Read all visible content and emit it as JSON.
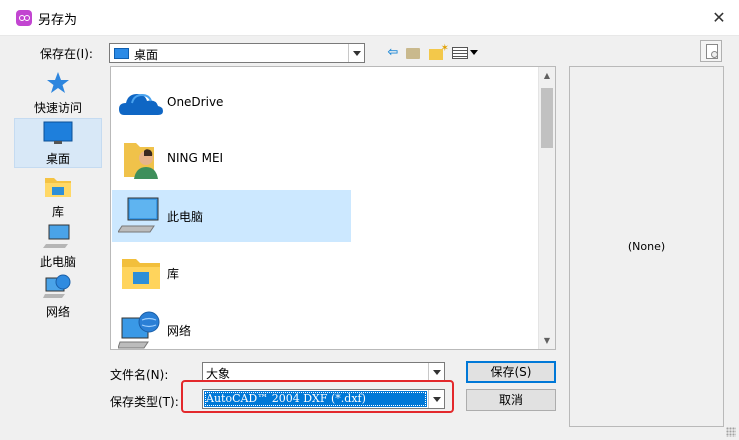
{
  "window": {
    "title": "另存为",
    "close_glyph": "✕"
  },
  "toolbar": {
    "save_in_label": "保存在(I):",
    "save_in_value": "桌面"
  },
  "places": [
    {
      "label": "快速访问"
    },
    {
      "label": "桌面"
    },
    {
      "label": "库"
    },
    {
      "label": "此电脑"
    },
    {
      "label": "网络"
    }
  ],
  "files": [
    {
      "label": "OneDrive"
    },
    {
      "label": "NING MEI"
    },
    {
      "label": "此电脑"
    },
    {
      "label": "库"
    },
    {
      "label": "网络"
    }
  ],
  "preview": {
    "text": "(None)"
  },
  "form": {
    "filename_label": "文件名(N):",
    "filename_value": "大象",
    "filetype_label": "保存类型(T):",
    "filetype_value": "AutoCAD™ 2004 DXF (*.dxf)"
  },
  "buttons": {
    "save": "保存(S)",
    "cancel": "取消"
  },
  "colors": {
    "selection": "#0078d7",
    "highlight": "#e3292c",
    "app_icon": "#c245d1"
  }
}
